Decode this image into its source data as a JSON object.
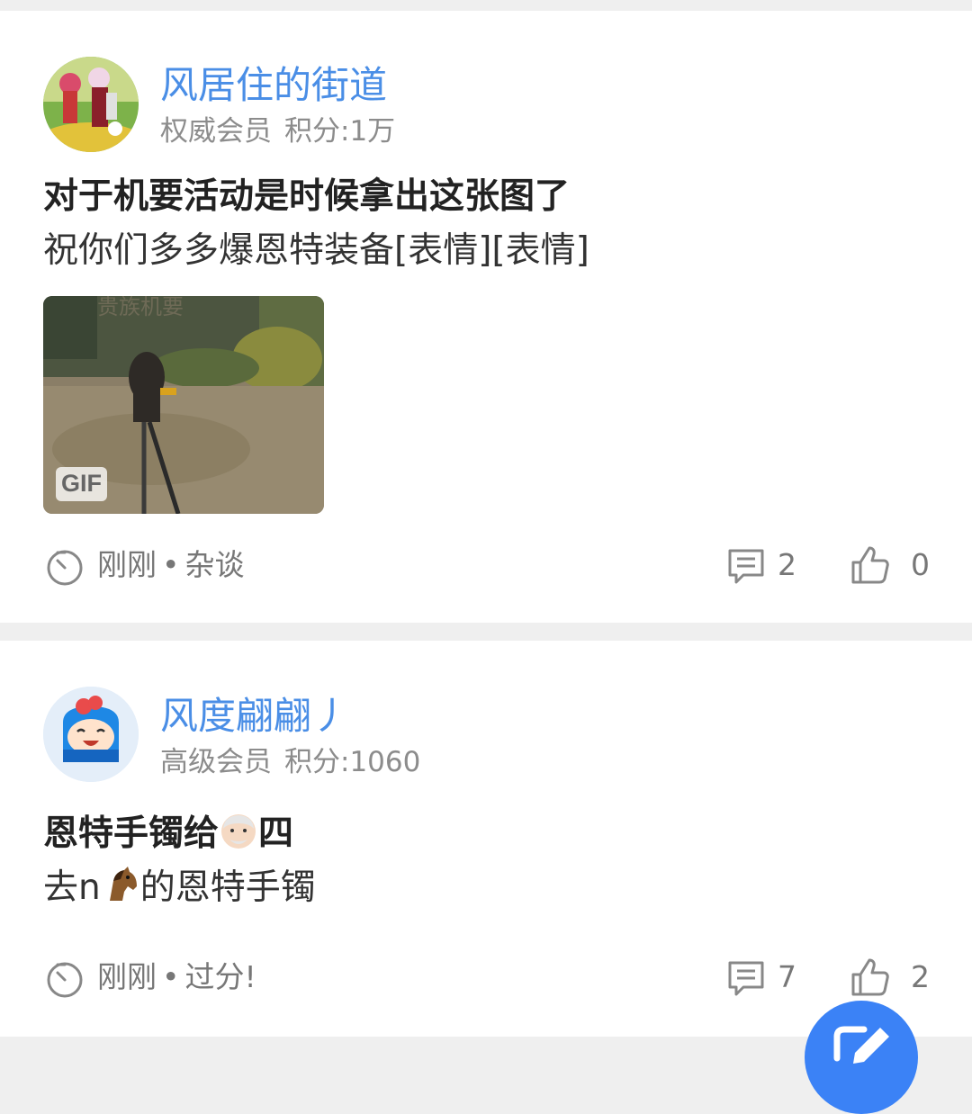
{
  "posts": [
    {
      "author": "风居住的街道",
      "rank": "权威会员",
      "score": "积分:1万",
      "title": "对于机要活动是时候拿出这张图了",
      "body": "祝你们多多爆恩特装备[表情][表情]",
      "image_watermark": "贵族机要",
      "image_badge": "GIF",
      "time": "刚刚",
      "separator": "•",
      "category": "杂谈",
      "comments": "2",
      "likes": "0"
    },
    {
      "author": "风度翩翩丿",
      "rank": "高级会员",
      "score": "积分:1060",
      "title_before": "恩特手镯给",
      "title_after": "四",
      "body_before": "去n",
      "body_after": "的恩特手镯",
      "time": "刚刚",
      "separator": "•",
      "category": "过分!",
      "comments": "7",
      "likes": "2"
    }
  ],
  "icons": {
    "clock": "clock-icon",
    "comment": "comment-icon",
    "like": "thumbs-up-icon",
    "emoji_old_man": "old-man-emoji",
    "emoji_horse": "horse-emoji",
    "compose": "pencil-icon"
  },
  "colors": {
    "username": "#4a8ee6",
    "fab": "#3b82f6",
    "background": "#efefef"
  }
}
